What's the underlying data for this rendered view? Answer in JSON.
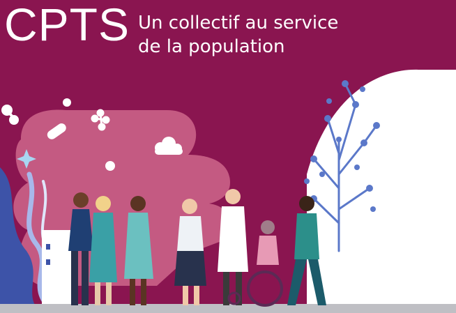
{
  "poster": {
    "title": "CPTS",
    "subtitle_line1": "Un collectif au service",
    "subtitle_line2": "de la population"
  },
  "colors": {
    "background": "#8a1550",
    "cloud_pink": "#c45a82",
    "text": "#ffffff",
    "tree": "#5b78c9"
  }
}
